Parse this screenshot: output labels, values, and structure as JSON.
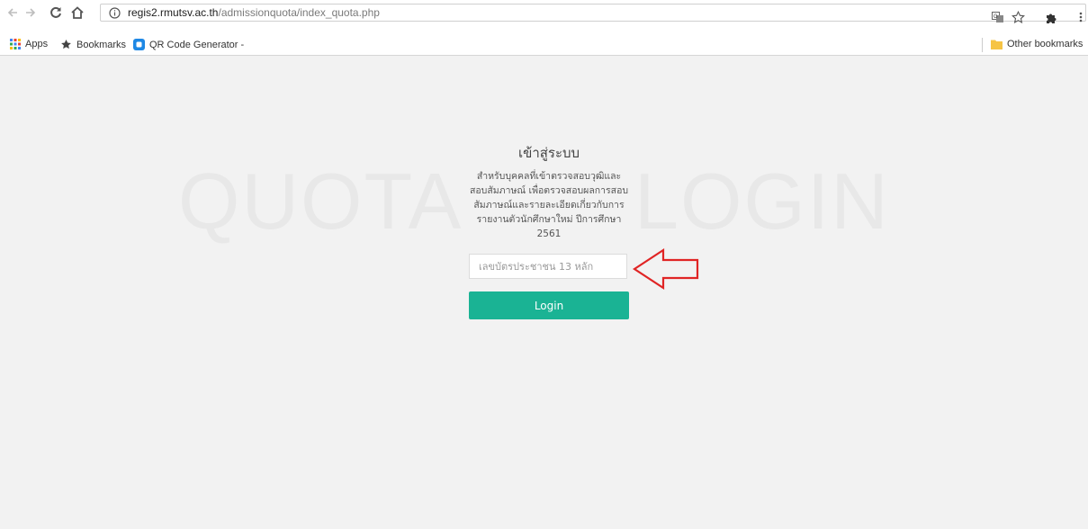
{
  "browser": {
    "url_host": "regis2.rmutsv.ac.th",
    "url_path": "/admissionquota/index_quota.php",
    "icons": {
      "back": "arrow-left-icon",
      "forward": "arrow-right-icon",
      "reload": "reload-icon",
      "home": "home-icon",
      "info": "info-icon",
      "translate": "translate-icon",
      "star": "star-icon",
      "extension": "puzzle-icon",
      "menu": "kebab-menu-icon"
    }
  },
  "bookmarks": {
    "apps": "Apps",
    "bookmarks": "Bookmarks",
    "qr": "QR Code Generator -",
    "other": "Other bookmarks"
  },
  "watermark": {
    "left": "QUOTA",
    "right": "LOGIN"
  },
  "login": {
    "title": "เข้าสู่ระบบ",
    "description": "สำหรับบุคคลที่เข้าตรวจสอบวุฒิและสอบสัมภาษณ์ เพื่อตรวจสอบผลการสอบสัมภาษณ์และรายละเอียดเกี่ยวกับการรายงานตัวนักศึกษาใหม่ ปีการศึกษา 2561",
    "input_placeholder": "เลขบัตรประชาชน 13 หลัก",
    "input_value": "",
    "button_label": "Login"
  },
  "colors": {
    "button": "#1ab394",
    "arrow": "#e02424",
    "page_bg": "#f2f2f2"
  }
}
